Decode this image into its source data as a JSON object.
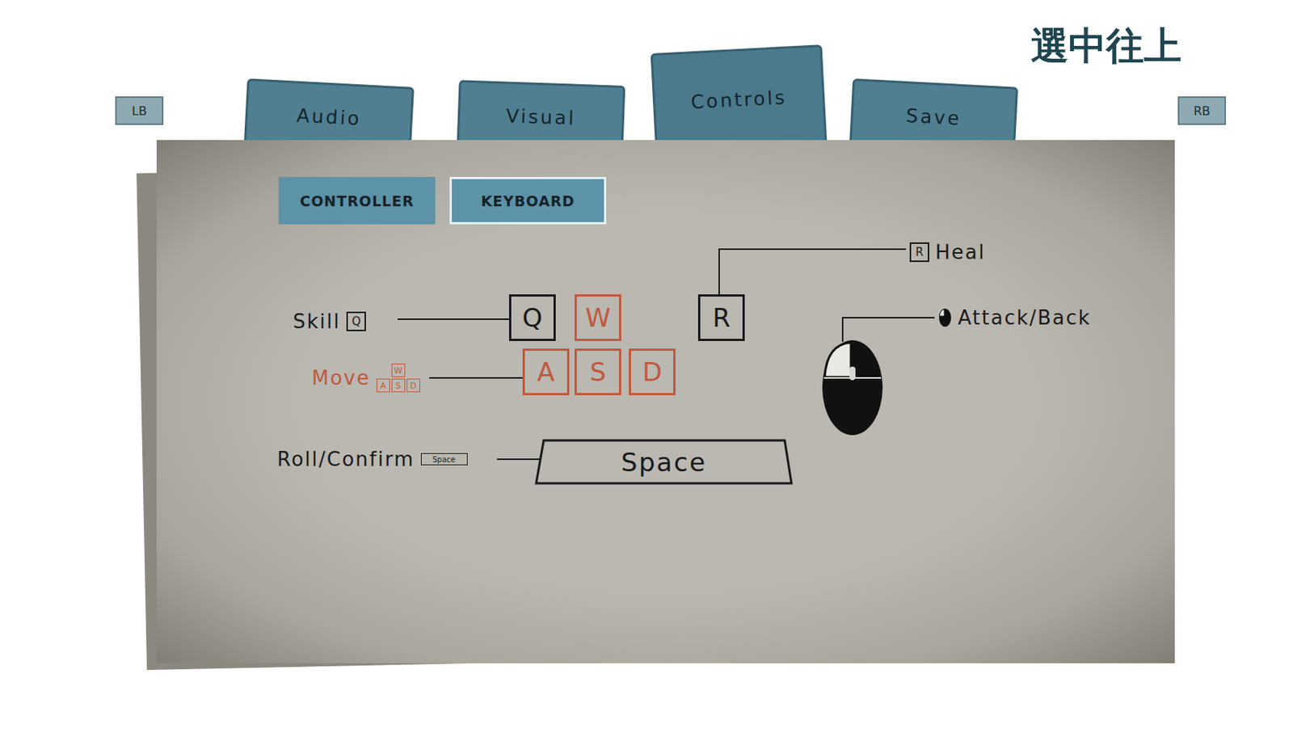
{
  "corner_hint": "選中往上",
  "shoulder_buttons": {
    "left": "LB",
    "right": "RB"
  },
  "tabs": [
    {
      "label": "Audio",
      "selected": false
    },
    {
      "label": "Visual",
      "selected": false
    },
    {
      "label": "Controls",
      "selected": true
    },
    {
      "label": "Save",
      "selected": false
    }
  ],
  "device_tabs": [
    {
      "label": "CONTROLLER",
      "selected": false
    },
    {
      "label": "KEYBOARD",
      "selected": true
    }
  ],
  "keys": [
    {
      "label": "Q",
      "highlighted": false,
      "kind": "key"
    },
    {
      "label": "W",
      "highlighted": true,
      "kind": "key"
    },
    {
      "label": "R",
      "highlighted": false,
      "kind": "key"
    },
    {
      "label": "A",
      "highlighted": true,
      "kind": "key"
    },
    {
      "label": "S",
      "highlighted": true,
      "kind": "key"
    },
    {
      "label": "D",
      "highlighted": true,
      "kind": "key"
    },
    {
      "label": "Space",
      "highlighted": false,
      "kind": "bar"
    }
  ],
  "bindings": [
    {
      "action": "Skill",
      "kind": "key",
      "icon_keys": [
        "Q"
      ],
      "highlighted": false
    },
    {
      "action": "Move",
      "kind": "key",
      "icon_keys": [
        "W",
        "A",
        "S",
        "D"
      ],
      "highlighted": true
    },
    {
      "action": "Roll/Confirm",
      "kind": "key",
      "icon_keys": [
        "Space"
      ],
      "highlighted": false
    },
    {
      "action": "Heal",
      "kind": "key",
      "icon_keys": [
        "R"
      ],
      "highlighted": false
    },
    {
      "action": "Attack/Back",
      "kind": "mouse",
      "icon_keys": [],
      "highlighted": false
    }
  ]
}
